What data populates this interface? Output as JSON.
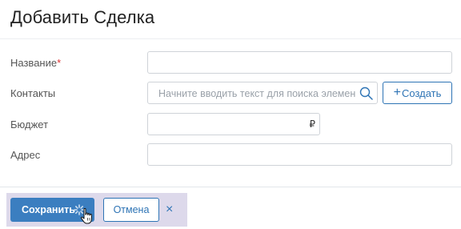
{
  "page": {
    "title": "Добавить Сделка"
  },
  "form": {
    "name": {
      "label": "Название",
      "required_mark": "*",
      "value": ""
    },
    "contacts": {
      "label": "Контакты",
      "placeholder": "Начните вводить текст для поиска элемента",
      "create_plus": "+",
      "create_label": "Создать"
    },
    "budget": {
      "label": "Бюджет",
      "currency": "₽",
      "value": ""
    },
    "address": {
      "label": "Адрес",
      "value": ""
    }
  },
  "footer": {
    "save_label": "Сохранить",
    "cancel_label": "Отмена",
    "close_glyph": "×"
  },
  "colors": {
    "accent": "#2e74b5",
    "primary_button": "#3b7ec0",
    "footer_highlight": "#ddd9eb",
    "required": "#dd3333"
  },
  "icons": [
    "search-icon",
    "spinner-icon",
    "hand-cursor-icon",
    "close-icon"
  ]
}
